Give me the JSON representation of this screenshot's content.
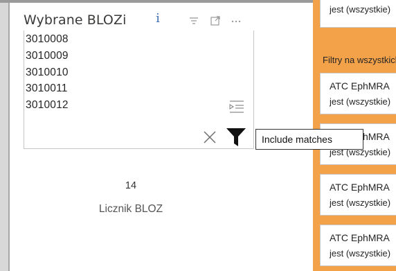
{
  "slicer": {
    "title": "Wybrane BLOZi",
    "info_glyph": "i",
    "items": [
      "3010008",
      "3010009",
      "3010010",
      "3010011",
      "3010012"
    ],
    "tooltip": "Include matches",
    "header_icons": [
      "filter-lines-icon",
      "focus-mode-icon",
      "more-options-icon"
    ]
  },
  "card": {
    "value": "14",
    "label": "Licznik BLOZ"
  },
  "filters_pane": {
    "top_card_sub": "jest (wszystkie)",
    "section_heading": "Filtry na wszystkich stronach",
    "cards": [
      {
        "title": "ATC EphMRA",
        "sub": "jest (wszystkie)"
      },
      {
        "title": "ATC EphMRA",
        "sub": "jest (wszystkie)"
      },
      {
        "title": "ATC EphMRA",
        "sub": "jest (wszystkie)"
      },
      {
        "title": "ATC EphMRA",
        "sub": "jest (wszystkie)"
      }
    ]
  },
  "colors": {
    "pane_background": "#f3a24a",
    "info_icon": "#3f6fb5",
    "text": "#252423"
  }
}
